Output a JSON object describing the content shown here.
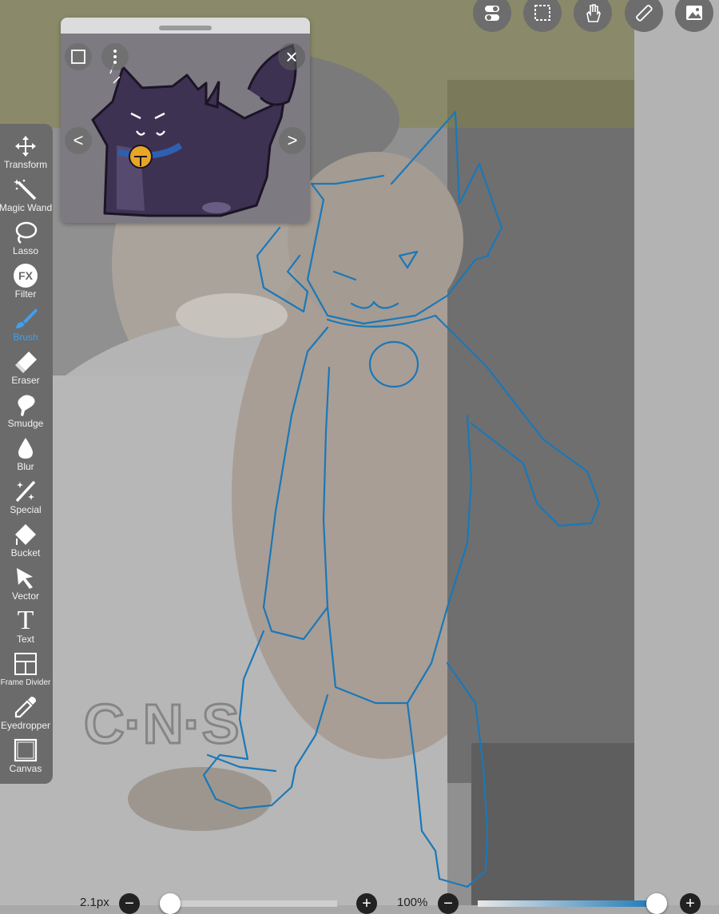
{
  "top_bar": {
    "buttons": [
      {
        "name": "toggle-icon"
      },
      {
        "name": "selection-icon"
      },
      {
        "name": "hand-icon"
      },
      {
        "name": "ruler-icon"
      },
      {
        "name": "gallery-icon"
      }
    ]
  },
  "toolbar": {
    "active": "Brush",
    "accent_color": "#3ea0f0",
    "tools": [
      {
        "label": "Transform",
        "icon": "transform-icon"
      },
      {
        "label": "Magic Wand",
        "icon": "magic-wand-icon"
      },
      {
        "label": "Lasso",
        "icon": "lasso-icon"
      },
      {
        "label": "Filter",
        "icon": "fx-icon"
      },
      {
        "label": "Brush",
        "icon": "brush-icon"
      },
      {
        "label": "Eraser",
        "icon": "eraser-icon"
      },
      {
        "label": "Smudge",
        "icon": "smudge-icon"
      },
      {
        "label": "Blur",
        "icon": "blur-drop-icon"
      },
      {
        "label": "Special",
        "icon": "special-icon"
      },
      {
        "label": "Bucket",
        "icon": "bucket-icon"
      },
      {
        "label": "Vector",
        "icon": "vector-cursor-icon"
      },
      {
        "label": "Text",
        "icon": "text-icon"
      },
      {
        "label": "Frame Divider",
        "icon": "frame-divider-icon"
      },
      {
        "label": "Eyedropper",
        "icon": "eyedropper-icon"
      },
      {
        "label": "Canvas",
        "icon": "canvas-icon"
      }
    ]
  },
  "reference_window": {
    "fx_glyph": "FX",
    "prev_glyph": "<",
    "next_glyph": ">",
    "close_glyph": "×"
  },
  "bottom_bar": {
    "brush_size": "2.1px",
    "opacity": "100%",
    "minus_glyph": "−",
    "plus_glyph": "+",
    "brush_size_level": 0.0,
    "opacity_level": 1.0
  },
  "colors": {
    "stroke_blue": "#1a78b8",
    "toolbar_bg": "#6b6b6b"
  }
}
